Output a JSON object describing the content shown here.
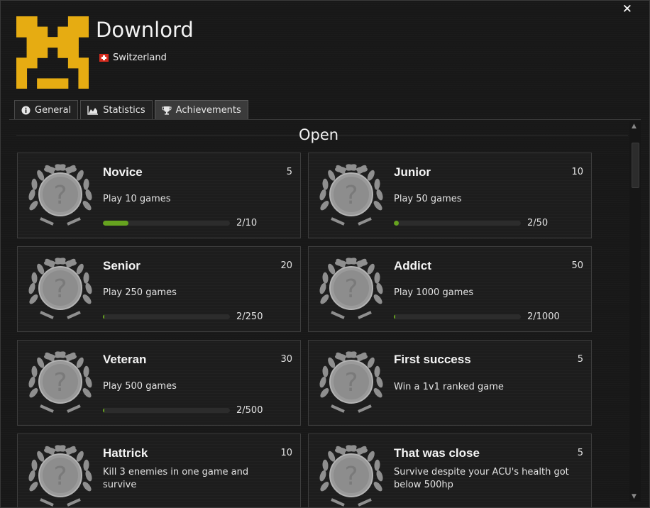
{
  "window": {
    "close_glyph": "✕"
  },
  "profile": {
    "username": "Downlord",
    "country": "Switzerland",
    "avatar_color": "#e6ac12",
    "flag_color": "#d52b1e"
  },
  "tabs": [
    {
      "label": "General",
      "icon": "info-icon",
      "active": false
    },
    {
      "label": "Statistics",
      "icon": "chart-icon",
      "active": false
    },
    {
      "label": "Achievements",
      "icon": "trophy-icon",
      "active": true
    }
  ],
  "section": {
    "title": "Open"
  },
  "colors": {
    "progress_fill": "#66a31f",
    "progress_track": "#2c2c2c",
    "badge_silver": "#9a9a9a"
  },
  "achievements": [
    {
      "title": "Novice",
      "points": "5",
      "description": "Play 10 games",
      "progress_text": "2/10",
      "progress_fraction": 0.2
    },
    {
      "title": "Junior",
      "points": "10",
      "description": "Play 50 games",
      "progress_text": "2/50",
      "progress_fraction": 0.04
    },
    {
      "title": "Senior",
      "points": "20",
      "description": "Play 250 games",
      "progress_text": "2/250",
      "progress_fraction": 0.008
    },
    {
      "title": "Addict",
      "points": "50",
      "description": "Play 1000 games",
      "progress_text": "2/1000",
      "progress_fraction": 0.002
    },
    {
      "title": "Veteran",
      "points": "30",
      "description": "Play 500 games",
      "progress_text": "2/500",
      "progress_fraction": 0.004
    },
    {
      "title": "First success",
      "points": "5",
      "description": "Win a 1v1 ranked game",
      "progress_text": "",
      "progress_fraction": null
    },
    {
      "title": "Hattrick",
      "points": "10",
      "description": "Kill 3 enemies in one game and survive",
      "progress_text": "",
      "progress_fraction": null
    },
    {
      "title": "That was close",
      "points": "5",
      "description": "Survive despite your ACU's health got below 500hp",
      "progress_text": "",
      "progress_fraction": null
    }
  ]
}
